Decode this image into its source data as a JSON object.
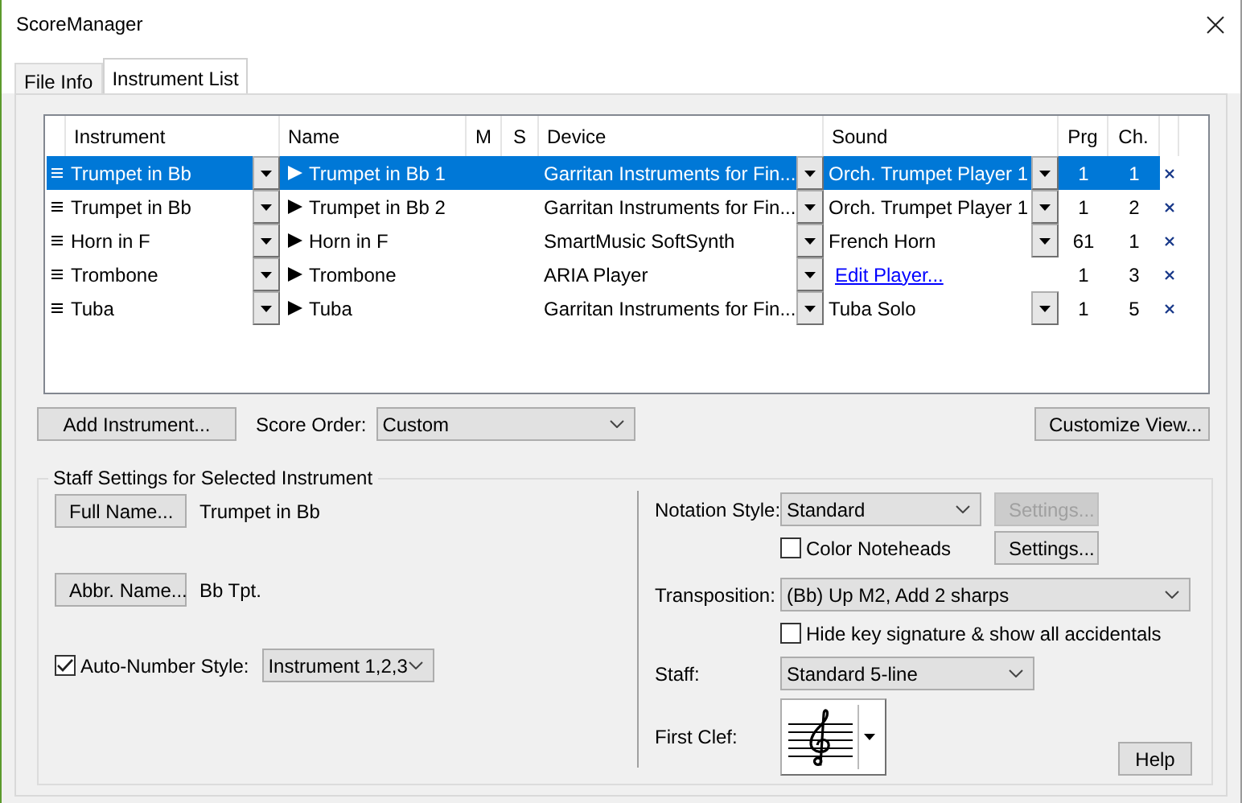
{
  "window": {
    "title": "ScoreManager"
  },
  "tabs": [
    {
      "label": "File Info",
      "selected": false
    },
    {
      "label": "Instrument List",
      "selected": true
    }
  ],
  "instrument_table": {
    "columns": [
      "Instrument",
      "Name",
      "M",
      "S",
      "Device",
      "Sound",
      "Prg",
      "Ch."
    ],
    "rows": [
      {
        "instrument": "Trumpet in Bb",
        "name": "Trumpet in Bb 1",
        "device": "Garritan Instruments for Fin...",
        "sound": {
          "kind": "select",
          "text": "Orch. Trumpet Player 1"
        },
        "prg": "1",
        "ch": "1",
        "selected": true
      },
      {
        "instrument": "Trumpet in Bb",
        "name": "Trumpet in Bb 2",
        "device": "Garritan Instruments for Fin...",
        "sound": {
          "kind": "select",
          "text": "Orch. Trumpet Player 1"
        },
        "prg": "1",
        "ch": "2",
        "selected": false
      },
      {
        "instrument": "Horn in F",
        "name": "Horn in F",
        "device": "SmartMusic SoftSynth",
        "sound": {
          "kind": "select",
          "text": "French Horn"
        },
        "prg": "61",
        "ch": "1",
        "selected": false
      },
      {
        "instrument": "Trombone",
        "name": "Trombone",
        "device": "ARIA Player",
        "sound": {
          "kind": "link",
          "text": "Edit Player..."
        },
        "prg": "1",
        "ch": "3",
        "selected": false
      },
      {
        "instrument": "Tuba",
        "name": "Tuba",
        "device": "Garritan Instruments for Fin...",
        "sound": {
          "kind": "select",
          "text": "Tuba Solo"
        },
        "prg": "1",
        "ch": "5",
        "selected": false
      }
    ]
  },
  "add_instrument_button": "Add Instrument...",
  "score_order": {
    "label": "Score Order:",
    "value": "Custom"
  },
  "customize_view_button": "Customize View...",
  "staff_settings": {
    "title": "Staff Settings for Selected Instrument",
    "full_name_button": "Full Name...",
    "full_name": "Trumpet in Bb",
    "abbr_name_button": "Abbr. Name...",
    "abbr_name": "Bb Tpt.",
    "auto_number": {
      "label": "Auto-Number Style:",
      "checked": true,
      "value": "Instrument 1,2,3"
    },
    "notation_style": {
      "label": "Notation Style:",
      "value": "Standard"
    },
    "notation_settings_button": {
      "label": "Settings...",
      "disabled": true
    },
    "color_noteheads": {
      "label": "Color Noteheads",
      "checked": false
    },
    "noteheads_settings_button": {
      "label": "Settings...",
      "disabled": false
    },
    "transposition": {
      "label": "Transposition:",
      "value": "(Bb) Up M2, Add 2 sharps"
    },
    "hide_key_signature": {
      "label": "Hide key signature & show all accidentals",
      "checked": false
    },
    "staff": {
      "label": "Staff:",
      "value": "Standard 5-line"
    },
    "first_clef": {
      "label": "First Clef:"
    }
  },
  "help_button": "Help"
}
